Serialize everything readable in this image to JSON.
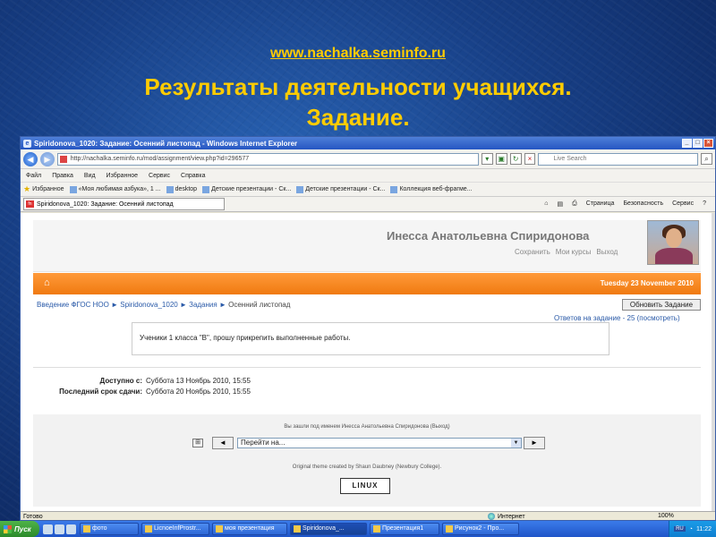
{
  "slide": {
    "url": "www.nachalka.seminfo.ru",
    "title_line1": "Результаты деятельности учащихся.",
    "title_line2": "Задание."
  },
  "browser": {
    "window_title": "Spiridonova_1020: Задание: Осенний листопад - Windows Internet Explorer",
    "address": "http://nachalka.seminfo.ru/mod/assignment/view.php?id=296577",
    "search_placeholder": "Live Search",
    "menu": [
      "Файл",
      "Правка",
      "Вид",
      "Избранное",
      "Сервис",
      "Справка"
    ],
    "favorites_label": "Избранное",
    "favorites": [
      "«Моя любимая азбука», 1 ...",
      "desktop",
      "Детские презентации - Ск...",
      "Детские презентации - Ск...",
      "Коллекция веб-фрагме..."
    ],
    "tab_title": "Spiridonova_1020: Задание: Осенний листопад",
    "tab_tools": [
      "Страница",
      "Безопасность",
      "Сервис"
    ],
    "status_left": "Готово",
    "status_zone": "Интернет",
    "zoom": "100%"
  },
  "page": {
    "username": "Инесса Анатольевна Спиридонова",
    "header_links": [
      "Сохранить",
      "Мои курсы",
      "Выход"
    ],
    "date": "Tuesday 23 November 2010",
    "breadcrumb": [
      "Введение ФГОС НОО",
      "Spiridonova_1020",
      "Задания",
      "Осенний листопад"
    ],
    "update_button": "Обновить Задание",
    "answers_link": "Ответов на задание - 25 (посмотреть)",
    "task_text": "Ученики 1 класса \"В\", прошу прикрепить выполненные работы.",
    "available_label": "Доступно с:",
    "available_value": "Суббота 13 Ноябрь 2010, 15:55",
    "deadline_label": "Последний срок сдачи:",
    "deadline_value": "Суббота 20 Ноябрь 2010, 15:55",
    "logged_in": "Вы зашли под именем Инесса Анатольевна Спиридонова (Выход)",
    "jump_placeholder": "Перейти на...",
    "theme_credit": "Original theme created by Shaun Daubney (Newbury College).",
    "footer_logo_text": "LINUX"
  },
  "taskbar": {
    "start_label": "Пуск",
    "buttons": [
      "фото",
      "LicnoeInfProstr...",
      "моя презентация",
      "Spiridonova_...",
      "Презентация1",
      "Рисунок2 - Про..."
    ],
    "lang": "RU",
    "clock": "11:22"
  },
  "colors": {
    "accent_orange": "#f07a10",
    "slide_title": "#ffcc00",
    "link_blue": "#2a5aa8"
  }
}
